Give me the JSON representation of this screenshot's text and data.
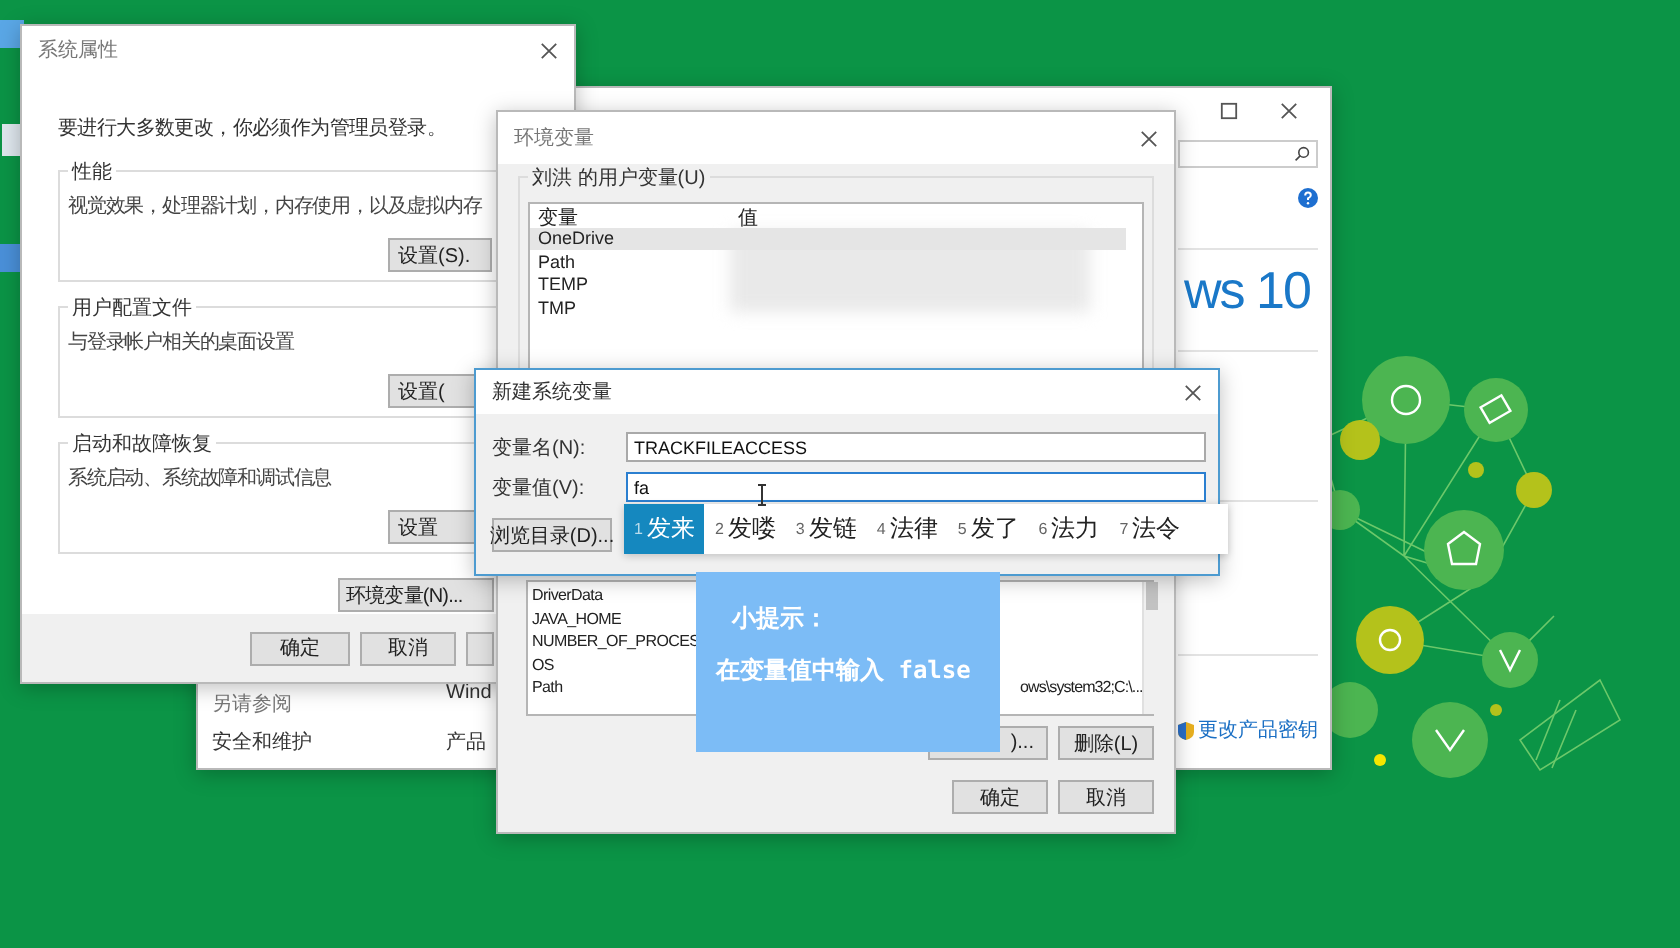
{
  "system_properties": {
    "title": "系统属性",
    "notice": "要进行大多数更改，你必须作为管理员登录。",
    "groups": [
      {
        "title": "性能",
        "description": "视觉效果，处理器计划，内存使用，以及虚拟内存",
        "button": "设置(S)."
      },
      {
        "title": "用户配置文件",
        "description": "与登录帐户相关的桌面设置",
        "button": "设置("
      },
      {
        "title": "启动和故障恢复",
        "description": "系统启动、系统故障和调试信息",
        "button": "设置"
      }
    ],
    "env_button": "环境变量(N)...",
    "buttons": [
      "确定",
      "取消"
    ]
  },
  "control_panel": {
    "logo_text": "ws 10",
    "see_also_title": "另请参阅",
    "see_also_link": "安全和维护",
    "windows_label": "Wind",
    "product_label": "产品",
    "product_key_link": "更改产品密钥"
  },
  "env_vars": {
    "title": "环境变量",
    "user_group": "刘洪 的用户变量(U)",
    "columns": [
      "变量",
      "值"
    ],
    "user_rows": [
      {
        "name": "OneDrive",
        "selected": true
      },
      {
        "name": "Path",
        "selected": false
      },
      {
        "name": "TEMP",
        "selected": false
      },
      {
        "name": "TMP",
        "selected": false
      }
    ],
    "system_rows": [
      {
        "name": "DriverData"
      },
      {
        "name": "JAVA_HOME"
      },
      {
        "name": "NUMBER_OF_PROCES"
      },
      {
        "name": "OS"
      },
      {
        "name": "Path",
        "value": "ows\\system32;C:\\..."
      }
    ],
    "buttons": [
      ")...",
      "删除(L)"
    ],
    "footer_buttons": [
      "确定",
      "取消"
    ]
  },
  "new_variable": {
    "title": "新建系统变量",
    "name_label": "变量名(N):",
    "name_value": "TRACKFILEACCESS",
    "value_label": "变量值(V):",
    "value_value": "fa",
    "browse_button": "浏览目录(D)..."
  },
  "ime": {
    "candidates": [
      {
        "number": "1",
        "text": "发来",
        "selected": true
      },
      {
        "number": "2",
        "text": "发喽",
        "selected": false
      },
      {
        "number": "3",
        "text": "发链",
        "selected": false
      },
      {
        "number": "4",
        "text": "法律",
        "selected": false
      },
      {
        "number": "5",
        "text": "发了",
        "selected": false
      },
      {
        "number": "6",
        "text": "法力",
        "selected": false
      },
      {
        "number": "7",
        "text": "法令",
        "selected": false
      }
    ]
  },
  "tip": {
    "title": "小提示：",
    "body": "在变量值中输入 false"
  }
}
